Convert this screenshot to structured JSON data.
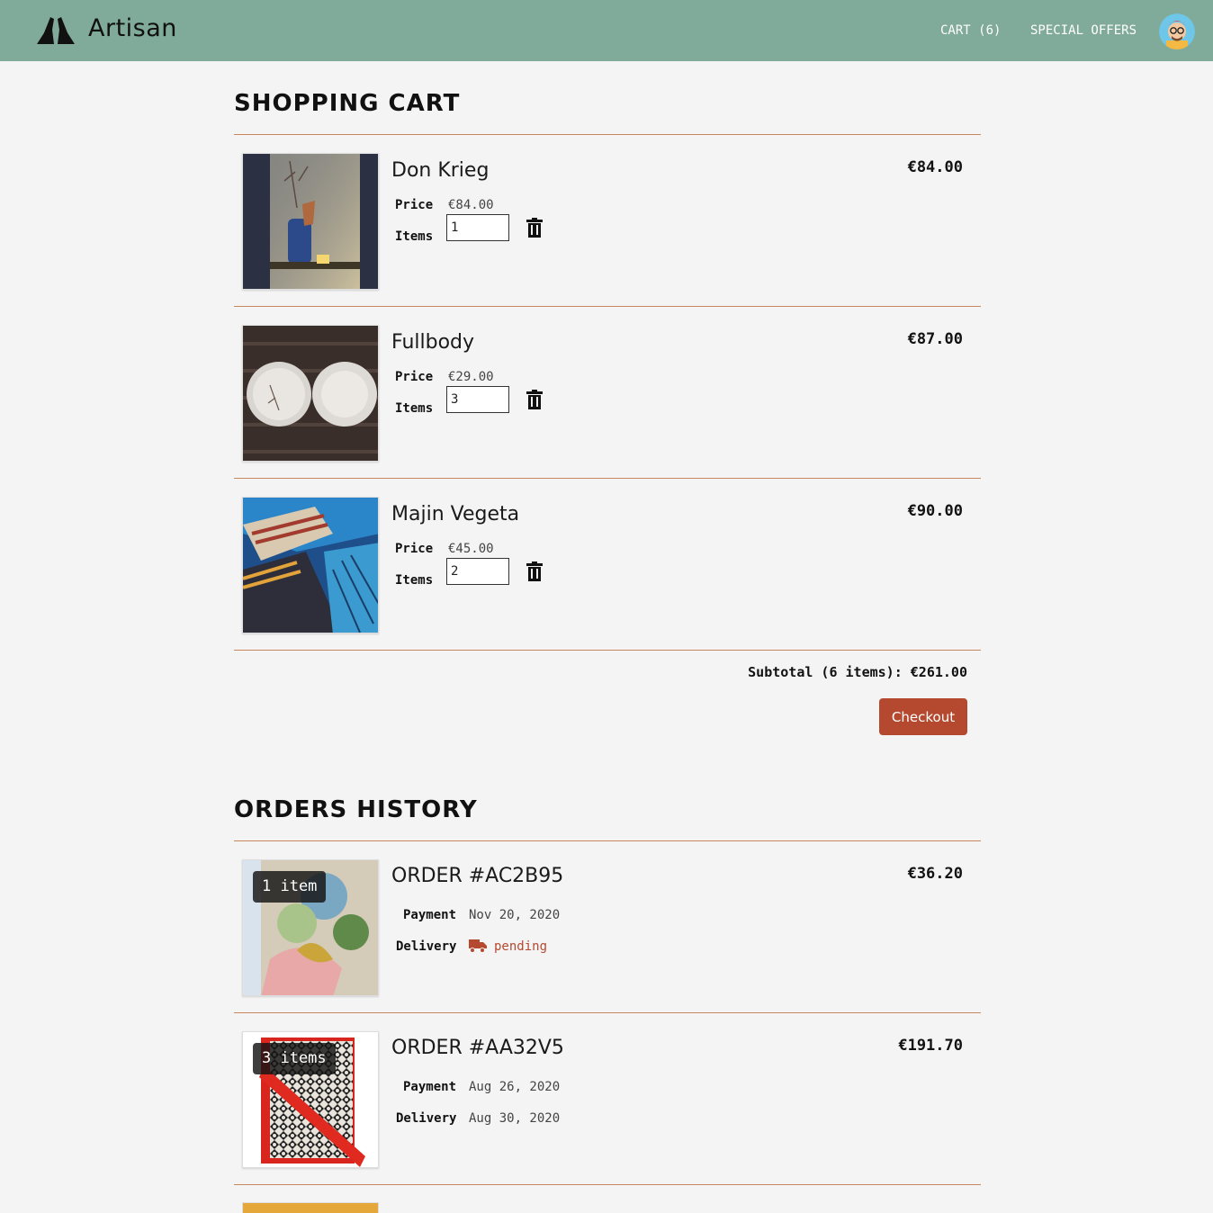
{
  "header": {
    "brand": "Artisan",
    "cart_label": "CART (6)",
    "offers_label": "SPECIAL OFFERS",
    "bg_color": "#80aa99"
  },
  "cart": {
    "title": "SHOPPING CART",
    "price_label": "Price",
    "items_label": "Items",
    "items": [
      {
        "name": "Don Krieg",
        "unit_price": "€84.00",
        "quantity": "1",
        "total": "€84.00"
      },
      {
        "name": "Fullbody",
        "unit_price": "€29.00",
        "quantity": "3",
        "total": "€87.00"
      },
      {
        "name": "Majin Vegeta",
        "unit_price": "€45.00",
        "quantity": "2",
        "total": "€90.00"
      }
    ],
    "subtotal": "Subtotal (6 items): €261.00",
    "checkout_label": "Checkout",
    "accent_color": "#b5492f"
  },
  "orders": {
    "title": "ORDERS HISTORY",
    "payment_label": "Payment",
    "delivery_label": "Delivery",
    "list": [
      {
        "id": "ORDER #AC2B95",
        "count": "1 item",
        "payment": "Nov 20, 2020",
        "delivery": "pending",
        "delivery_icon": "truck-icon",
        "total": "€36.20"
      },
      {
        "id": "ORDER #AA32V5",
        "count": "3 items",
        "payment": "Aug 26, 2020",
        "delivery": "Aug 30, 2020",
        "total": "€191.70"
      }
    ]
  }
}
